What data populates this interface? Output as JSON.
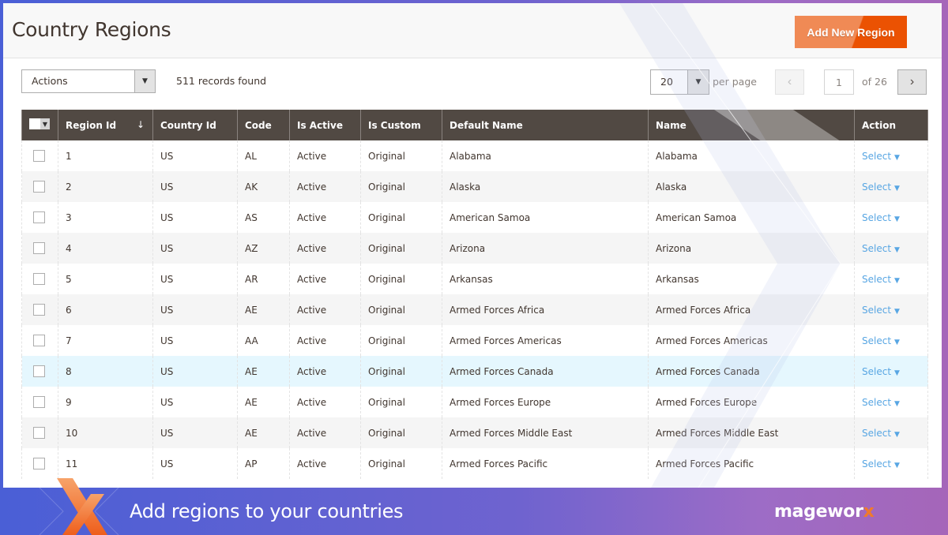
{
  "header": {
    "title": "Country Regions",
    "add_button": "Add New Region"
  },
  "toolbar": {
    "actions_label": "Actions",
    "records_found": "511 records found",
    "per_page_value": "20",
    "per_page_label": "per page",
    "prev_icon": "‹",
    "current_page": "1",
    "page_of": "of 26",
    "next_icon": "›"
  },
  "grid": {
    "columns": [
      "Region Id",
      "Country Id",
      "Code",
      "Is Active",
      "Is Custom",
      "Default Name",
      "Name",
      "Action"
    ],
    "sort_indicator": "↓",
    "rows": [
      {
        "id": "1",
        "country": "US",
        "code": "AL",
        "active": "Active",
        "custom": "Original",
        "default_name": "Alabama",
        "name": "Alabama",
        "action": "Select"
      },
      {
        "id": "2",
        "country": "US",
        "code": "AK",
        "active": "Active",
        "custom": "Original",
        "default_name": "Alaska",
        "name": "Alaska",
        "action": "Select"
      },
      {
        "id": "3",
        "country": "US",
        "code": "AS",
        "active": "Active",
        "custom": "Original",
        "default_name": "American Samoa",
        "name": "American Samoa",
        "action": "Select"
      },
      {
        "id": "4",
        "country": "US",
        "code": "AZ",
        "active": "Active",
        "custom": "Original",
        "default_name": "Arizona",
        "name": "Arizona",
        "action": "Select"
      },
      {
        "id": "5",
        "country": "US",
        "code": "AR",
        "active": "Active",
        "custom": "Original",
        "default_name": "Arkansas",
        "name": "Arkansas",
        "action": "Select"
      },
      {
        "id": "6",
        "country": "US",
        "code": "AE",
        "active": "Active",
        "custom": "Original",
        "default_name": "Armed Forces Africa",
        "name": "Armed Forces Africa",
        "action": "Select"
      },
      {
        "id": "7",
        "country": "US",
        "code": "AA",
        "active": "Active",
        "custom": "Original",
        "default_name": "Armed Forces Americas",
        "name": "Armed Forces Americas",
        "action": "Select"
      },
      {
        "id": "8",
        "country": "US",
        "code": "AE",
        "active": "Active",
        "custom": "Original",
        "default_name": "Armed Forces Canada",
        "name": "Armed Forces Canada",
        "action": "Select"
      },
      {
        "id": "9",
        "country": "US",
        "code": "AE",
        "active": "Active",
        "custom": "Original",
        "default_name": "Armed Forces Europe",
        "name": "Armed Forces Europe",
        "action": "Select"
      },
      {
        "id": "10",
        "country": "US",
        "code": "AE",
        "active": "Active",
        "custom": "Original",
        "default_name": "Armed Forces Middle East",
        "name": "Armed Forces Middle East",
        "action": "Select"
      },
      {
        "id": "11",
        "country": "US",
        "code": "AP",
        "active": "Active",
        "custom": "Original",
        "default_name": "Armed Forces Pacific",
        "name": "Armed Forces Pacific",
        "action": "Select"
      }
    ],
    "highlighted_row": "8"
  },
  "banner": {
    "text": "Add regions to your countries",
    "brand_main": "magewor",
    "brand_x": "x"
  },
  "colors": {
    "accent_orange": "#eb5202",
    "header_dark": "#514943",
    "link_blue": "#58a6e3",
    "highlight_row": "#e5f7fe"
  }
}
